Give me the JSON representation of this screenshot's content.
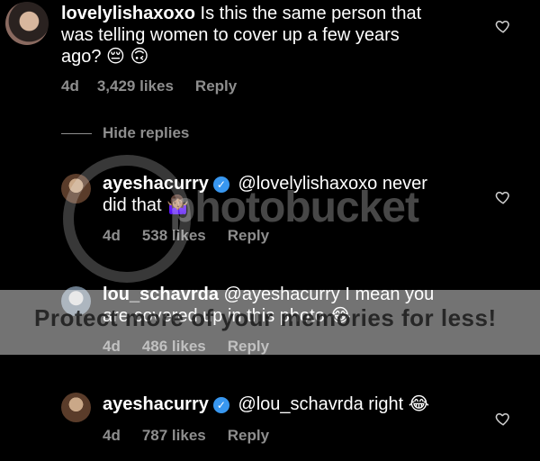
{
  "comments": [
    {
      "username": "lovelylishaxoxo",
      "verified": false,
      "text_line1": "Is this the same person that",
      "text_line2": "was telling women to cover up a few years",
      "text_line3": "ago? 😔 🙃",
      "age": "4d",
      "likes": "3,429 likes",
      "reply": "Reply"
    },
    {
      "username": "ayeshacurry",
      "verified": true,
      "mention": "@lovelylishaxoxo",
      "text_line1": "never",
      "text_line2": "did that 🤷🏽‍♀️",
      "age": "4d",
      "likes": "538 likes",
      "reply": "Reply"
    },
    {
      "username": "lou_schavrda",
      "verified": false,
      "mention": "@ayeshacurry",
      "text_line1": "I mean you",
      "text_line2": "are covered up in this photo 😂",
      "age": "4d",
      "likes": "486 likes",
      "reply": "Reply"
    },
    {
      "username": "ayeshacurry",
      "verified": true,
      "mention": "@lou_schavrda",
      "text_line1": "right 😂",
      "age": "4d",
      "likes": "787 likes",
      "reply": "Reply"
    }
  ],
  "hide_replies": "Hide replies",
  "verified_mark": "✓",
  "watermark": {
    "logo": "photobucket",
    "tagline": "Protect more of your memories for less!"
  },
  "colors": {
    "background": "#000000",
    "text": "#ffffff",
    "muted": "#8e8e8e",
    "verified": "#3897f0"
  },
  "icons": [
    "heart-icon",
    "verified-badge-icon"
  ]
}
